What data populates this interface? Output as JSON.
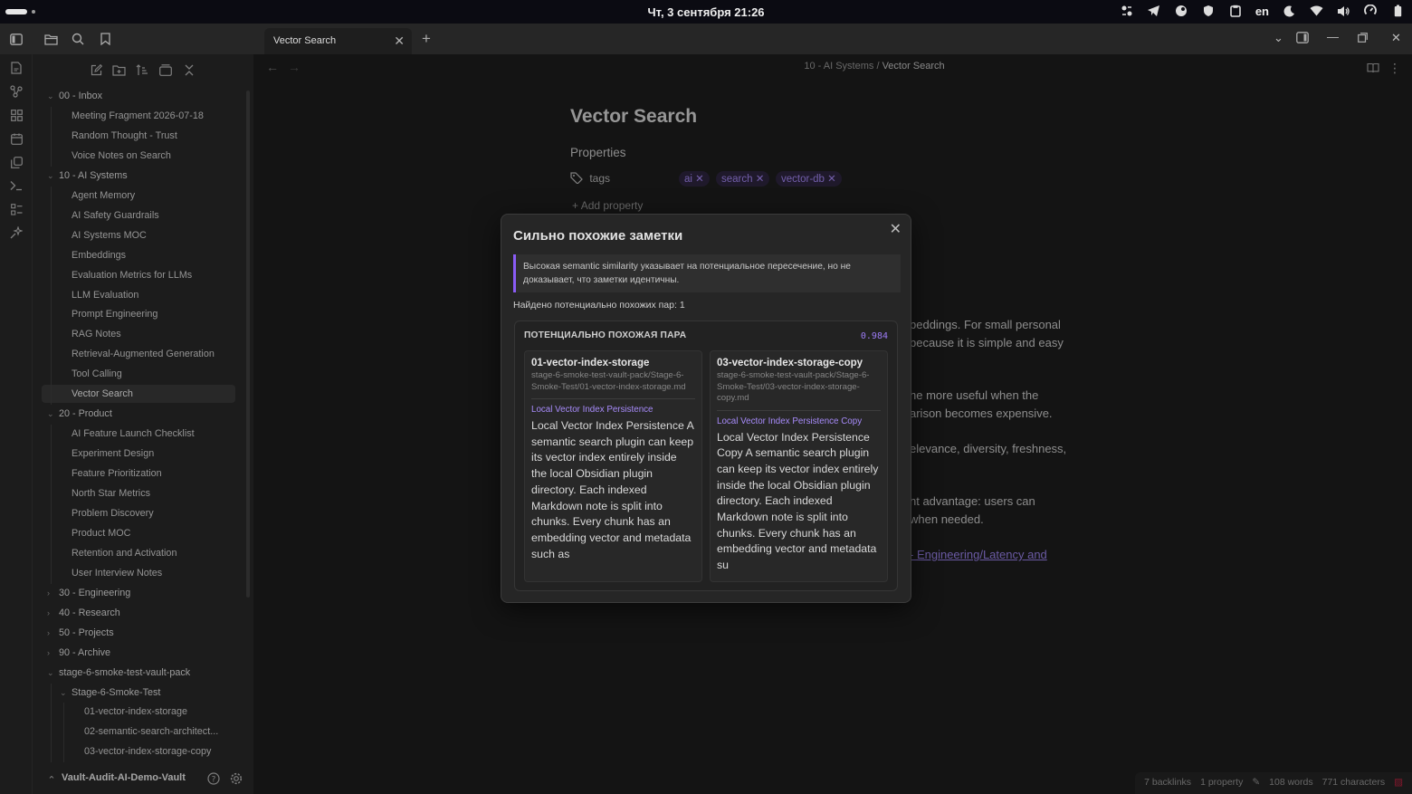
{
  "topbar": {
    "date_time": "Чт, 3 сентября  21:26",
    "language": "en"
  },
  "tabs": [
    {
      "label": "Vector Search"
    }
  ],
  "breadcrumb": {
    "folder": "10 - AI Systems",
    "separator": "/",
    "current": "Vector Search"
  },
  "tree": [
    {
      "label": "00 - Inbox",
      "type": "folder",
      "open": true,
      "depth": 0
    },
    {
      "label": "Meeting Fragment 2026-07-18",
      "type": "file",
      "depth": 1
    },
    {
      "label": "Random Thought - Trust",
      "type": "file",
      "depth": 1
    },
    {
      "label": "Voice Notes on Search",
      "type": "file",
      "depth": 1
    },
    {
      "label": "10 - AI Systems",
      "type": "folder",
      "open": true,
      "depth": 0
    },
    {
      "label": "Agent Memory",
      "type": "file",
      "depth": 1
    },
    {
      "label": "AI Safety Guardrails",
      "type": "file",
      "depth": 1
    },
    {
      "label": "AI Systems MOC",
      "type": "file",
      "depth": 1
    },
    {
      "label": "Embeddings",
      "type": "file",
      "depth": 1
    },
    {
      "label": "Evaluation Metrics for LLMs",
      "type": "file",
      "depth": 1
    },
    {
      "label": "LLM Evaluation",
      "type": "file",
      "depth": 1
    },
    {
      "label": "Prompt Engineering",
      "type": "file",
      "depth": 1
    },
    {
      "label": "RAG Notes",
      "type": "file",
      "depth": 1
    },
    {
      "label": "Retrieval-Augmented Generation",
      "type": "file",
      "depth": 1
    },
    {
      "label": "Tool Calling",
      "type": "file",
      "depth": 1
    },
    {
      "label": "Vector Search",
      "type": "file",
      "depth": 1,
      "active": true
    },
    {
      "label": "20 - Product",
      "type": "folder",
      "open": true,
      "depth": 0
    },
    {
      "label": "AI Feature Launch Checklist",
      "type": "file",
      "depth": 1
    },
    {
      "label": "Experiment Design",
      "type": "file",
      "depth": 1
    },
    {
      "label": "Feature Prioritization",
      "type": "file",
      "depth": 1
    },
    {
      "label": "North Star Metrics",
      "type": "file",
      "depth": 1
    },
    {
      "label": "Problem Discovery",
      "type": "file",
      "depth": 1
    },
    {
      "label": "Product MOC",
      "type": "file",
      "depth": 1
    },
    {
      "label": "Retention and Activation",
      "type": "file",
      "depth": 1
    },
    {
      "label": "User Interview Notes",
      "type": "file",
      "depth": 1
    },
    {
      "label": "30 - Engineering",
      "type": "folder",
      "open": false,
      "depth": 0
    },
    {
      "label": "40 - Research",
      "type": "folder",
      "open": false,
      "depth": 0
    },
    {
      "label": "50 - Projects",
      "type": "folder",
      "open": false,
      "depth": 0
    },
    {
      "label": "90 - Archive",
      "type": "folder",
      "open": false,
      "depth": 0
    },
    {
      "label": "stage-6-smoke-test-vault-pack",
      "type": "folder",
      "open": true,
      "depth": 0
    },
    {
      "label": "Stage-6-Smoke-Test",
      "type": "folder",
      "open": true,
      "depth": 1
    },
    {
      "label": "01-vector-index-storage",
      "type": "file",
      "depth": 2
    },
    {
      "label": "02-semantic-search-architect...",
      "type": "file",
      "depth": 2
    },
    {
      "label": "03-vector-index-storage-copy",
      "type": "file",
      "depth": 2
    }
  ],
  "vault": {
    "name": "Vault-Audit-AI-Demo-Vault"
  },
  "note": {
    "title": "Vector Search",
    "properties_heading": "Properties",
    "prop_name": "tags",
    "tags": [
      "ai",
      "search",
      "vector-db"
    ],
    "add_property": "Add property",
    "visible_lines": [
      {
        "text": "beddings. For small personal",
        "link": false
      },
      {
        "text": "because it is simple and easy",
        "link": false
      },
      {
        "text": "he more useful when the",
        "link": false
      },
      {
        "text": "arison becomes expensive.",
        "link": false
      },
      {
        "text": "elevance, diversity, freshness,",
        "link": false
      },
      {
        "text": "nt advantage: users can",
        "link": false
      },
      {
        "text": "when needed.",
        "link": false
      },
      {
        "text": "- Engineering/Latency and",
        "link": true
      }
    ]
  },
  "status": {
    "backlinks": "7 backlinks",
    "properties": "1 property",
    "words": "108 words",
    "characters": "771 characters"
  },
  "modal": {
    "title": "Сильно похожие заметки",
    "callout": "Высокая semantic similarity указывает на потенциальное пересечение, но не доказывает, что заметки идентичны.",
    "found": "Найдено потенциально похожих пар: 1",
    "pair": {
      "heading": "ПОТЕНЦИАЛЬНО ПОХОЖАЯ ПАРА",
      "score": "0.984",
      "left": {
        "title": "01-vector-index-storage",
        "path": "stage-6-smoke-test-vault-pack/Stage-6-Smoke-Test/01-vector-index-storage.md",
        "section": "Local Vector Index Persistence",
        "snippet": "Local Vector Index Persistence A semantic search plugin can keep its vector index entirely inside the local Obsidian plugin directory. Each indexed Markdown note is split into chunks. Every chunk has an embedding vector and metadata such as"
      },
      "right": {
        "title": "03-vector-index-storage-copy",
        "path": "stage-6-smoke-test-vault-pack/Stage-6-Smoke-Test/03-vector-index-storage-copy.md",
        "section": "Local Vector Index Persistence Copy",
        "snippet": "Local Vector Index Persistence Copy A semantic search plugin can keep its vector index entirely inside the local Obsidian plugin directory. Each indexed Markdown note is split into chunks. Every chunk has an embedding vector and metadata su"
      }
    }
  },
  "colors": {
    "accent": "#8a5cf5",
    "tag_text": "#a88bfa",
    "background": "#1e1e1e",
    "panel": "#262626"
  }
}
